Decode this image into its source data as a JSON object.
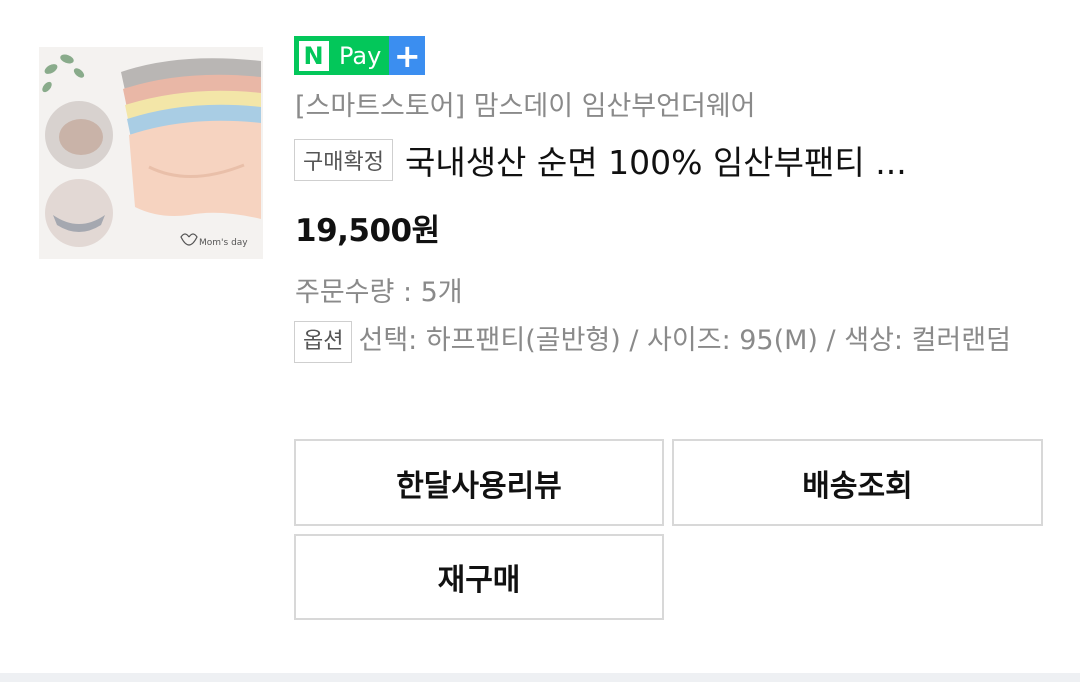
{
  "product": {
    "image_icon": "product-thumbnail",
    "image_brand": "Mom's day",
    "npay": {
      "n": "N",
      "pay": "Pay",
      "plus": "+"
    },
    "store": "[스마트스토어] 맘스데이 임산부언더웨어",
    "status_tag": "구매확정",
    "title": "국내생산 순면 100% 임산부팬티 ...",
    "price": "19,500원",
    "quantity": "주문수량 : 5개",
    "option_tag": "옵션",
    "option_text": "선택: 하프팬티(골반형) / 사이즈: 95(M) / 색상: 컬러랜덤"
  },
  "actions": {
    "review": "한달사용리뷰",
    "shipping": "배송조회",
    "rebuy": "재구매"
  },
  "colors": {
    "npay_green": "#03c75a",
    "npay_plus_blue": "#3b8ef0",
    "muted_text": "#8a8a8a",
    "border": "#d8d8d8"
  }
}
